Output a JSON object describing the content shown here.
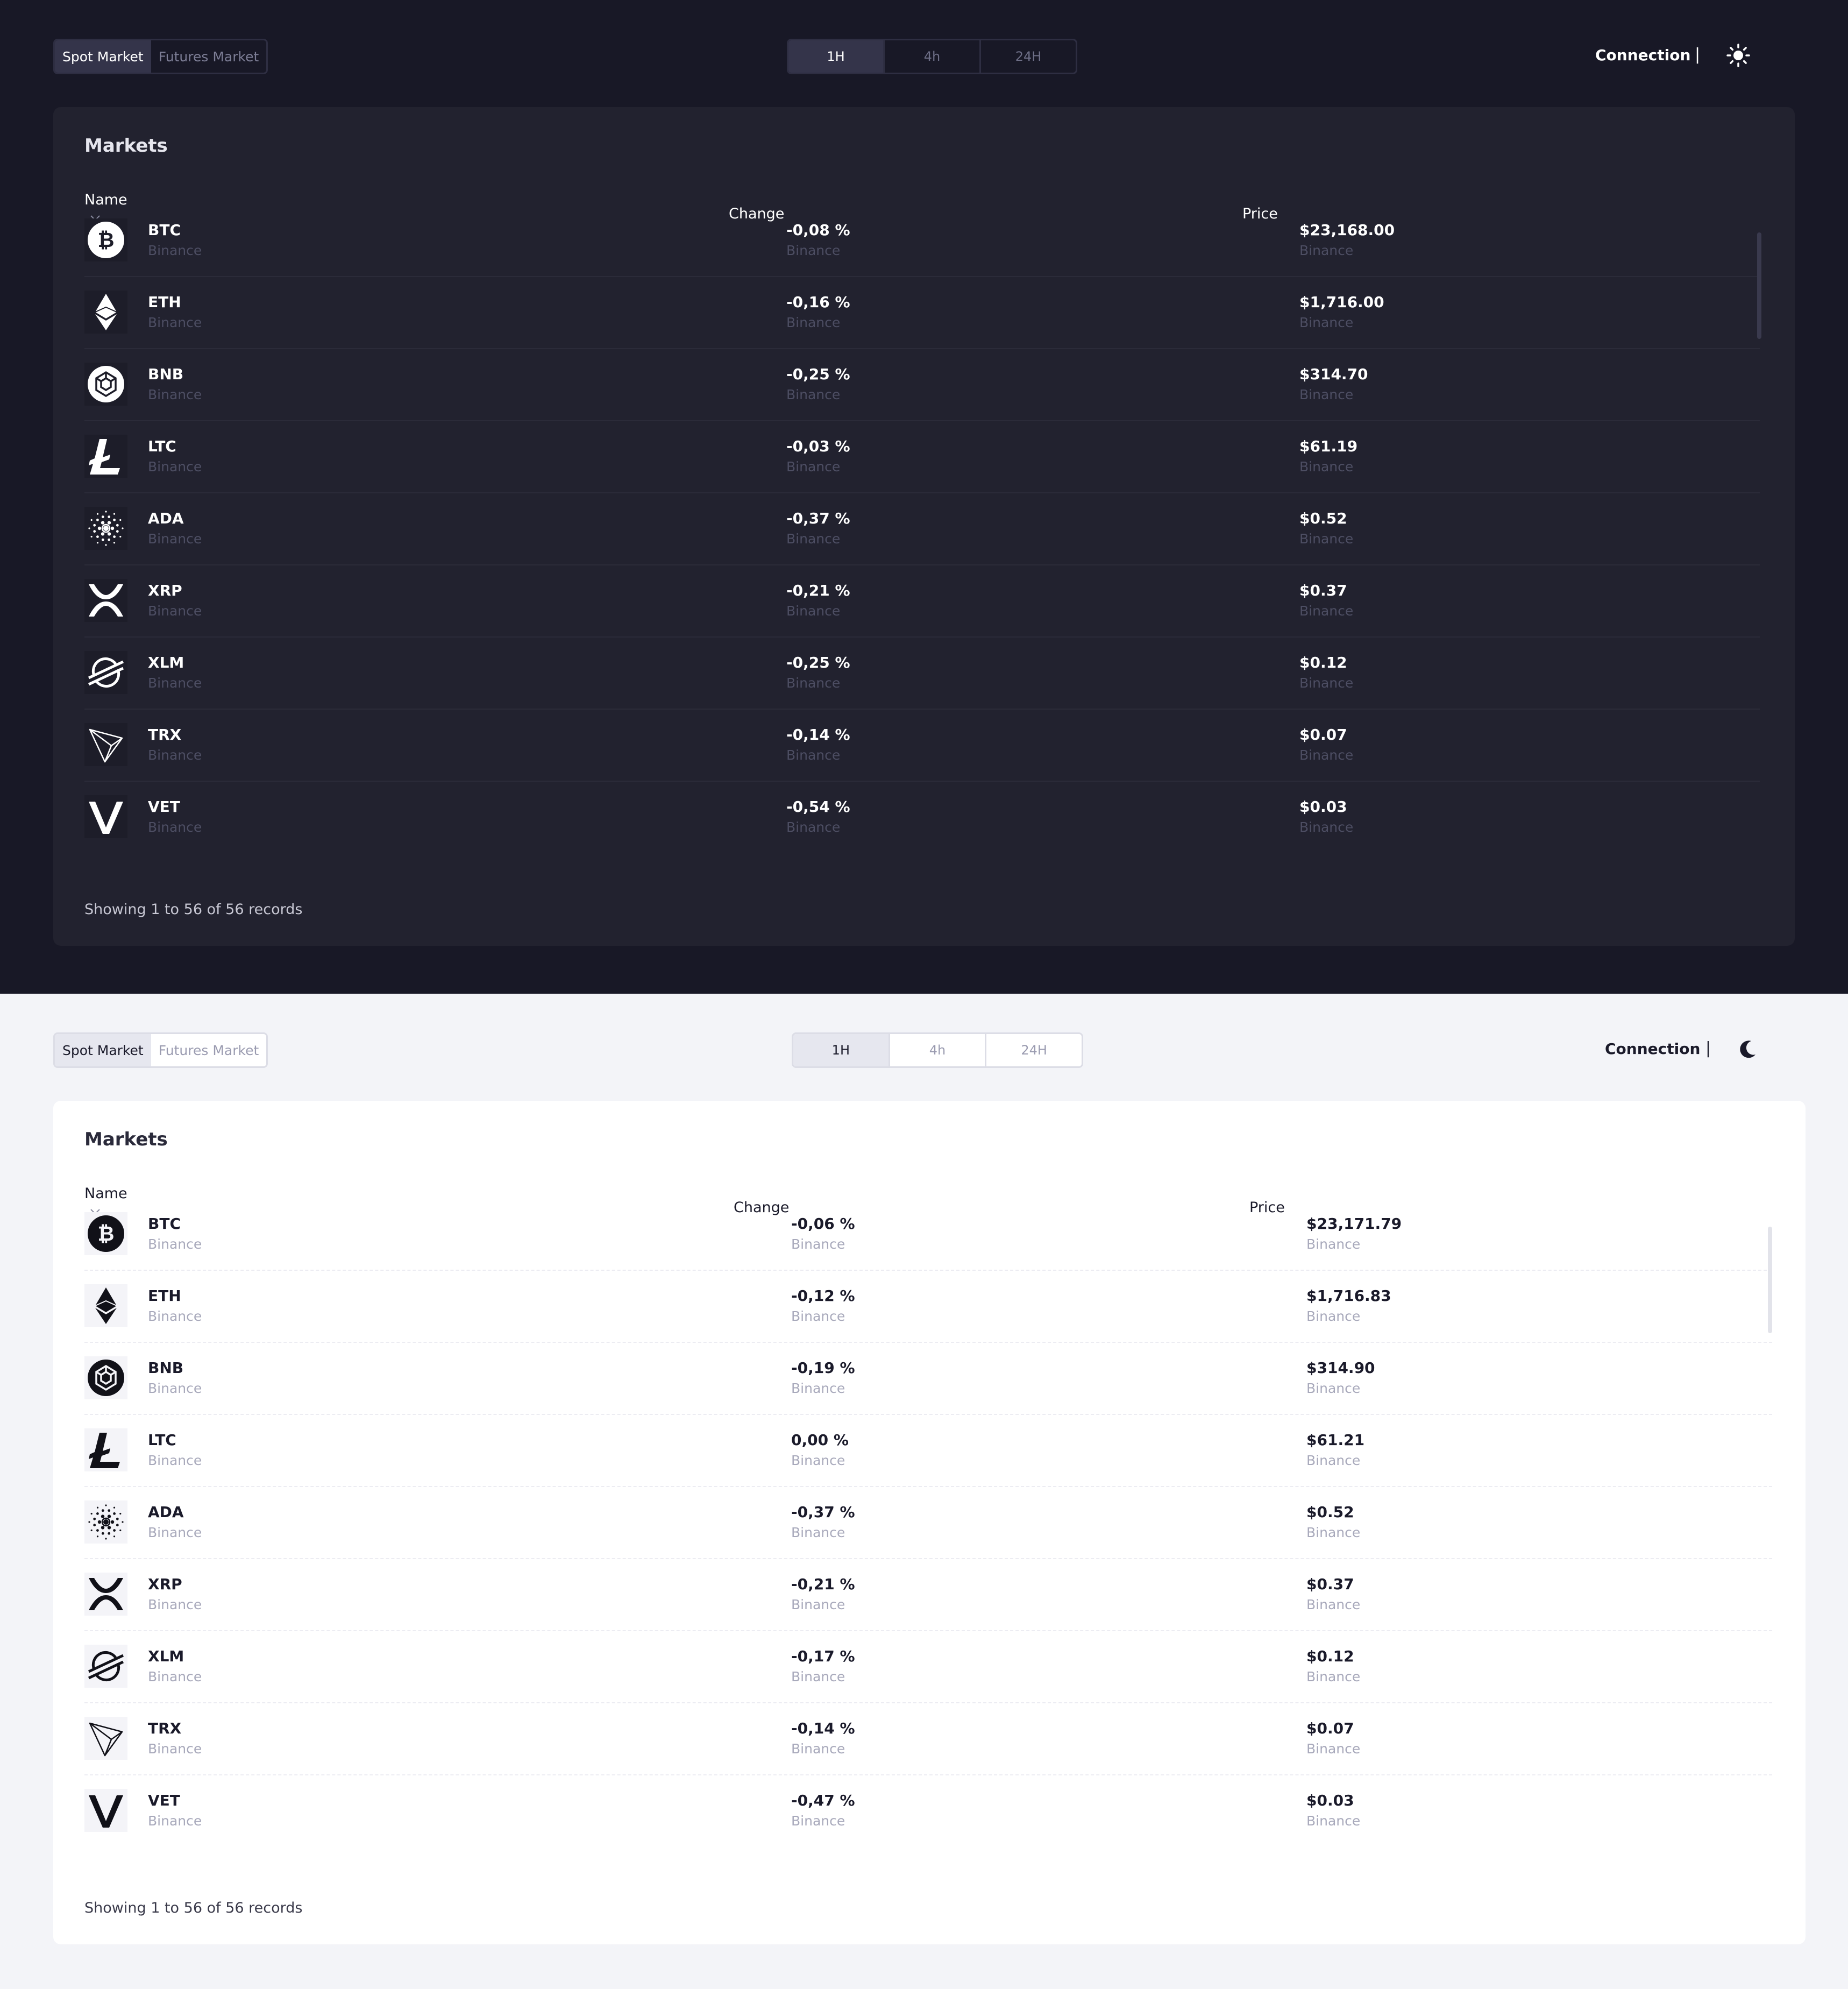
{
  "dark": {
    "market_tabs": [
      "Spot Market",
      "Futures Market"
    ],
    "time_tabs": [
      "1H",
      "4h",
      "24H"
    ],
    "connection": "Connection",
    "separator": "|",
    "theme_icon": "sun-icon",
    "card": {
      "title": "Markets",
      "headers": {
        "name": "Name",
        "change": "Change",
        "price": "Price"
      },
      "rows": [
        {
          "symbol": "BTC",
          "icon": "bitcoin-icon",
          "exchange": "Binance",
          "change": "-0,08 %",
          "price": "$23,168.00"
        },
        {
          "symbol": "ETH",
          "icon": "ethereum-icon",
          "exchange": "Binance",
          "change": "-0,16 %",
          "price": "$1,716.00"
        },
        {
          "symbol": "BNB",
          "icon": "bnb-icon",
          "exchange": "Binance",
          "change": "-0,25 %",
          "price": "$314.70"
        },
        {
          "symbol": "LTC",
          "icon": "litecoin-icon",
          "exchange": "Binance",
          "change": "-0,03 %",
          "price": "$61.19"
        },
        {
          "symbol": "ADA",
          "icon": "cardano-icon",
          "exchange": "Binance",
          "change": "-0,37 %",
          "price": "$0.52"
        },
        {
          "symbol": "XRP",
          "icon": "xrp-icon",
          "exchange": "Binance",
          "change": "-0,21 %",
          "price": "$0.37"
        },
        {
          "symbol": "XLM",
          "icon": "stellar-icon",
          "exchange": "Binance",
          "change": "-0,25 %",
          "price": "$0.12"
        },
        {
          "symbol": "TRX",
          "icon": "tron-icon",
          "exchange": "Binance",
          "change": "-0,14 %",
          "price": "$0.07"
        },
        {
          "symbol": "VET",
          "icon": "vechain-icon",
          "exchange": "Binance",
          "change": "-0,54 %",
          "price": "$0.03"
        }
      ],
      "footer": "Showing 1 to 56 of 56 records"
    }
  },
  "light": {
    "market_tabs": [
      "Spot Market",
      "Futures Market"
    ],
    "time_tabs": [
      "1H",
      "4h",
      "24H"
    ],
    "connection": "Connection",
    "separator": "|",
    "theme_icon": "moon-icon",
    "card": {
      "title": "Markets",
      "headers": {
        "name": "Name",
        "change": "Change",
        "price": "Price"
      },
      "rows": [
        {
          "symbol": "BTC",
          "icon": "bitcoin-icon",
          "exchange": "Binance",
          "change": "-0,06 %",
          "price": "$23,171.79"
        },
        {
          "symbol": "ETH",
          "icon": "ethereum-icon",
          "exchange": "Binance",
          "change": "-0,12 %",
          "price": "$1,716.83"
        },
        {
          "symbol": "BNB",
          "icon": "bnb-icon",
          "exchange": "Binance",
          "change": "-0,19 %",
          "price": "$314.90"
        },
        {
          "symbol": "LTC",
          "icon": "litecoin-icon",
          "exchange": "Binance",
          "change": "0,00 %",
          "price": "$61.21"
        },
        {
          "symbol": "ADA",
          "icon": "cardano-icon",
          "exchange": "Binance",
          "change": "-0,37 %",
          "price": "$0.52"
        },
        {
          "symbol": "XRP",
          "icon": "xrp-icon",
          "exchange": "Binance",
          "change": "-0,21 %",
          "price": "$0.37"
        },
        {
          "symbol": "XLM",
          "icon": "stellar-icon",
          "exchange": "Binance",
          "change": "-0,17 %",
          "price": "$0.12"
        },
        {
          "symbol": "TRX",
          "icon": "tron-icon",
          "exchange": "Binance",
          "change": "-0,14 %",
          "price": "$0.07"
        },
        {
          "symbol": "VET",
          "icon": "vechain-icon",
          "exchange": "Binance",
          "change": "-0,47 %",
          "price": "$0.03"
        }
      ],
      "footer": "Showing 1 to 56 of 56 records"
    }
  }
}
